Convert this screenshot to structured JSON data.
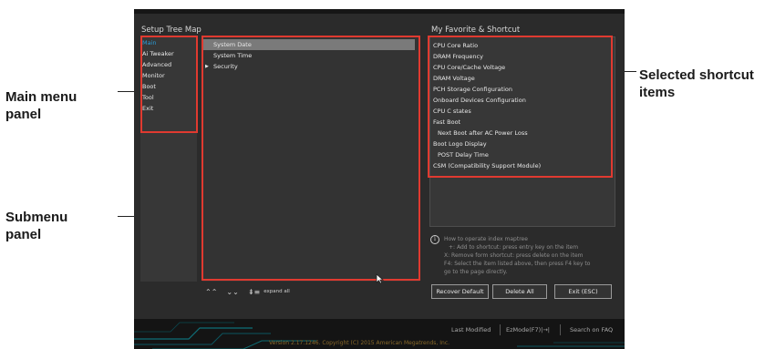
{
  "annotations": {
    "main_menu": [
      "Main menu",
      "panel"
    ],
    "submenu": [
      "Submenu",
      "panel"
    ],
    "shortcut": [
      "Selected shortcut",
      "items"
    ]
  },
  "tree_map": {
    "title": "Setup Tree Map",
    "menu_items": [
      "Main",
      "Ai Tweaker",
      "Advanced",
      "Monitor",
      "Boot",
      "Tool",
      "Exit"
    ],
    "active_menu": "Main",
    "submenu_items": [
      "System Date",
      "System Time",
      "Security"
    ]
  },
  "favorites": {
    "title": "My Favorite & Shortcut",
    "items": [
      "CPU Core Ratio",
      "DRAM Frequency",
      "CPU Core/Cache Voltage",
      "DRAM Voltage",
      "PCH Storage Configuration",
      "Onboard Devices Configuration",
      "CPU C states",
      "Fast Boot",
      "Next Boot after AC Power Loss",
      "Boot Logo Display",
      "POST Delay Time",
      "CSM (Compatibility Support Module)"
    ]
  },
  "help": {
    "icon": "i",
    "lines": [
      "How to operate index maptree",
      "+: Add to shortcut: press entry key on the item",
      "X: Remove form shortcut: press delete on the item",
      "F4: Select the item listed above, then press F4 key to",
      "go to the page directly."
    ]
  },
  "buttons": {
    "recover": "Recover Default",
    "delete_all": "Delete All",
    "exit": "Exit (ESC)"
  },
  "toolbar": {
    "collapse_icon": "⌃⌃",
    "expand_icon": "⌄⌄",
    "expand_all_icon": "⇟≡",
    "expand_all_label": "expand all"
  },
  "bottom_bar": {
    "last_modified": "Last Modified",
    "ez_mode": "EzMode(F7)|→|",
    "search": "Search on FAQ",
    "copyright": "Version 2.17.1246. Copyright (C) 2015 American Megatrends, Inc."
  },
  "colors": {
    "accent_red": "#e03a30",
    "active_blue": "#2a9bd7"
  }
}
